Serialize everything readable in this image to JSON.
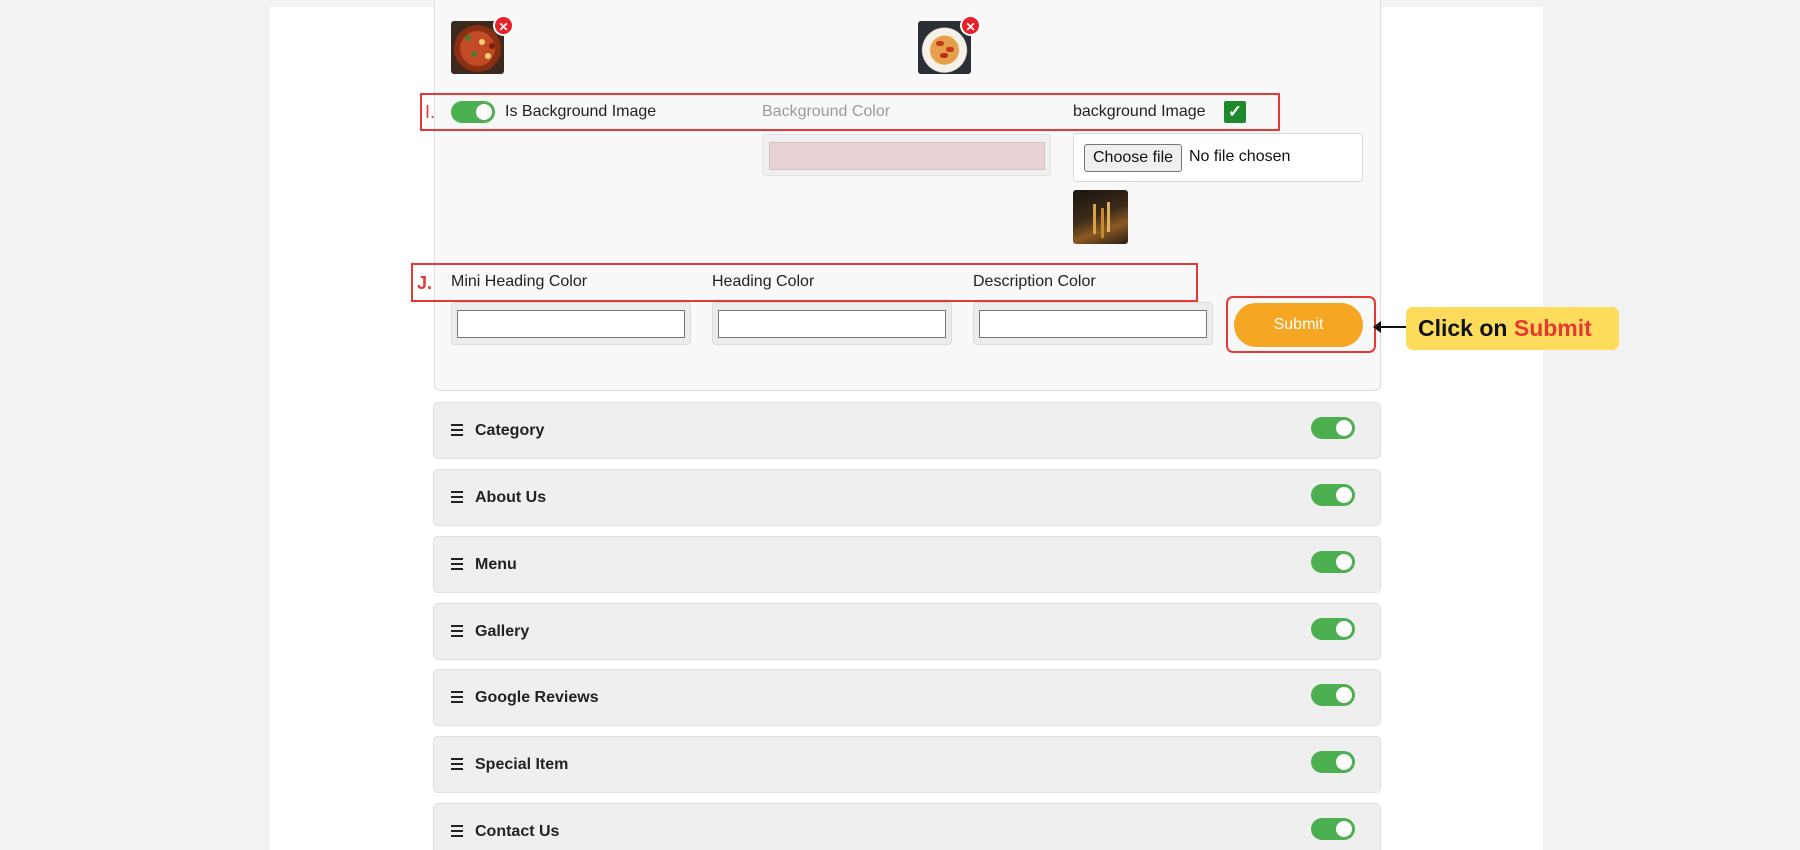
{
  "background_settings": {
    "is_background_image_label": "Is Background Image",
    "background_color_label": "Background Color",
    "background_image_label": "background Image",
    "file_button_label": "Choose file",
    "file_status": "No file chosen"
  },
  "color_settings": {
    "mini_heading_label": "Mini Heading Color",
    "heading_label": "Heading Color",
    "description_label": "Description Color",
    "mini_heading_value": "",
    "heading_value": "",
    "description_value": ""
  },
  "submit_label": "Submit",
  "annotations": {
    "marker_i": "I.",
    "marker_j": "J.",
    "callout_prefix": "Click on",
    "callout_target": "Submit"
  },
  "sections": [
    {
      "title": "Category",
      "enabled": true
    },
    {
      "title": "About Us",
      "enabled": true
    },
    {
      "title": "Menu",
      "enabled": true
    },
    {
      "title": "Gallery",
      "enabled": true
    },
    {
      "title": "Google Reviews",
      "enabled": true
    },
    {
      "title": "Special Item",
      "enabled": true
    },
    {
      "title": "Contact Us",
      "enabled": true
    }
  ],
  "colors": {
    "toggle_on": "#4caf50",
    "submit": "#f5a623",
    "annotation": "#e53935",
    "callout_bg": "#fddc5c",
    "background_color_value": "#ead3d5"
  }
}
